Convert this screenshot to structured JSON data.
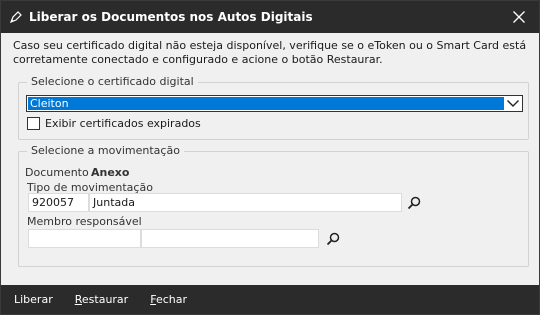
{
  "window": {
    "title": "Liberar os Documentos nos Autos Digitais",
    "close_icon": "close-icon",
    "app_icon": "pen-icon"
  },
  "info_text": "Caso seu certificado digital não esteja disponível, verifique se o eToken ou o Smart Card está corretamente conectado e configurado e acione o botão Restaurar.",
  "certificate": {
    "legend": "Selecione o certificado digital",
    "selected": "Cleiton",
    "show_expired_label": "Exibir certificados expirados",
    "show_expired_checked": false
  },
  "movement": {
    "legend": "Selecione a movimentação",
    "document_label": "Documento",
    "document_value": "Anexo",
    "tipo_label": "Tipo de movimentação",
    "tipo_code": "920057",
    "tipo_desc": "Juntada",
    "membro_label": "Membro responsável",
    "membro_code": "",
    "membro_desc": ""
  },
  "footer": {
    "liberar": "Liberar",
    "restaurar_mn": "R",
    "restaurar_rest": "estaurar",
    "fechar_mn": "F",
    "fechar_rest": "echar"
  },
  "colors": {
    "titlebar": "#2b2b2b",
    "selection": "#0078d7",
    "body": "#f0f0f0"
  }
}
